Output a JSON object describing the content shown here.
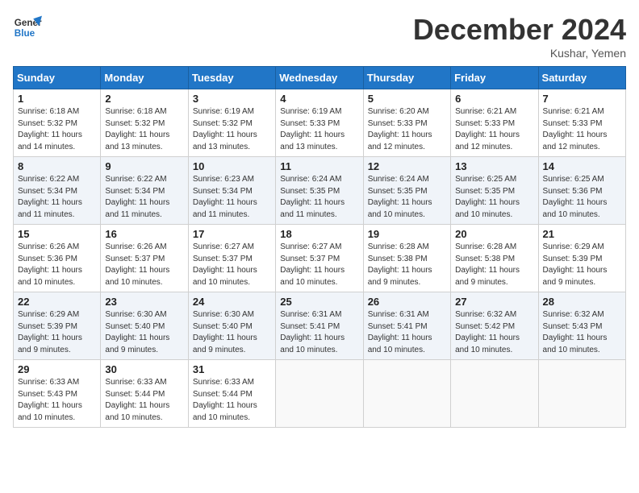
{
  "logo": {
    "line1": "General",
    "line2": "Blue"
  },
  "title": "December 2024",
  "location": "Kushar, Yemen",
  "weekdays": [
    "Sunday",
    "Monday",
    "Tuesday",
    "Wednesday",
    "Thursday",
    "Friday",
    "Saturday"
  ],
  "weeks": [
    [
      {
        "day": "1",
        "info": "Sunrise: 6:18 AM\nSunset: 5:32 PM\nDaylight: 11 hours\nand 14 minutes."
      },
      {
        "day": "2",
        "info": "Sunrise: 6:18 AM\nSunset: 5:32 PM\nDaylight: 11 hours\nand 13 minutes."
      },
      {
        "day": "3",
        "info": "Sunrise: 6:19 AM\nSunset: 5:32 PM\nDaylight: 11 hours\nand 13 minutes."
      },
      {
        "day": "4",
        "info": "Sunrise: 6:19 AM\nSunset: 5:33 PM\nDaylight: 11 hours\nand 13 minutes."
      },
      {
        "day": "5",
        "info": "Sunrise: 6:20 AM\nSunset: 5:33 PM\nDaylight: 11 hours\nand 12 minutes."
      },
      {
        "day": "6",
        "info": "Sunrise: 6:21 AM\nSunset: 5:33 PM\nDaylight: 11 hours\nand 12 minutes."
      },
      {
        "day": "7",
        "info": "Sunrise: 6:21 AM\nSunset: 5:33 PM\nDaylight: 11 hours\nand 12 minutes."
      }
    ],
    [
      {
        "day": "8",
        "info": "Sunrise: 6:22 AM\nSunset: 5:34 PM\nDaylight: 11 hours\nand 11 minutes."
      },
      {
        "day": "9",
        "info": "Sunrise: 6:22 AM\nSunset: 5:34 PM\nDaylight: 11 hours\nand 11 minutes."
      },
      {
        "day": "10",
        "info": "Sunrise: 6:23 AM\nSunset: 5:34 PM\nDaylight: 11 hours\nand 11 minutes."
      },
      {
        "day": "11",
        "info": "Sunrise: 6:24 AM\nSunset: 5:35 PM\nDaylight: 11 hours\nand 11 minutes."
      },
      {
        "day": "12",
        "info": "Sunrise: 6:24 AM\nSunset: 5:35 PM\nDaylight: 11 hours\nand 10 minutes."
      },
      {
        "day": "13",
        "info": "Sunrise: 6:25 AM\nSunset: 5:35 PM\nDaylight: 11 hours\nand 10 minutes."
      },
      {
        "day": "14",
        "info": "Sunrise: 6:25 AM\nSunset: 5:36 PM\nDaylight: 11 hours\nand 10 minutes."
      }
    ],
    [
      {
        "day": "15",
        "info": "Sunrise: 6:26 AM\nSunset: 5:36 PM\nDaylight: 11 hours\nand 10 minutes."
      },
      {
        "day": "16",
        "info": "Sunrise: 6:26 AM\nSunset: 5:37 PM\nDaylight: 11 hours\nand 10 minutes."
      },
      {
        "day": "17",
        "info": "Sunrise: 6:27 AM\nSunset: 5:37 PM\nDaylight: 11 hours\nand 10 minutes."
      },
      {
        "day": "18",
        "info": "Sunrise: 6:27 AM\nSunset: 5:37 PM\nDaylight: 11 hours\nand 10 minutes."
      },
      {
        "day": "19",
        "info": "Sunrise: 6:28 AM\nSunset: 5:38 PM\nDaylight: 11 hours\nand 9 minutes."
      },
      {
        "day": "20",
        "info": "Sunrise: 6:28 AM\nSunset: 5:38 PM\nDaylight: 11 hours\nand 9 minutes."
      },
      {
        "day": "21",
        "info": "Sunrise: 6:29 AM\nSunset: 5:39 PM\nDaylight: 11 hours\nand 9 minutes."
      }
    ],
    [
      {
        "day": "22",
        "info": "Sunrise: 6:29 AM\nSunset: 5:39 PM\nDaylight: 11 hours\nand 9 minutes."
      },
      {
        "day": "23",
        "info": "Sunrise: 6:30 AM\nSunset: 5:40 PM\nDaylight: 11 hours\nand 9 minutes."
      },
      {
        "day": "24",
        "info": "Sunrise: 6:30 AM\nSunset: 5:40 PM\nDaylight: 11 hours\nand 9 minutes."
      },
      {
        "day": "25",
        "info": "Sunrise: 6:31 AM\nSunset: 5:41 PM\nDaylight: 11 hours\nand 10 minutes."
      },
      {
        "day": "26",
        "info": "Sunrise: 6:31 AM\nSunset: 5:41 PM\nDaylight: 11 hours\nand 10 minutes."
      },
      {
        "day": "27",
        "info": "Sunrise: 6:32 AM\nSunset: 5:42 PM\nDaylight: 11 hours\nand 10 minutes."
      },
      {
        "day": "28",
        "info": "Sunrise: 6:32 AM\nSunset: 5:43 PM\nDaylight: 11 hours\nand 10 minutes."
      }
    ],
    [
      {
        "day": "29",
        "info": "Sunrise: 6:33 AM\nSunset: 5:43 PM\nDaylight: 11 hours\nand 10 minutes."
      },
      {
        "day": "30",
        "info": "Sunrise: 6:33 AM\nSunset: 5:44 PM\nDaylight: 11 hours\nand 10 minutes."
      },
      {
        "day": "31",
        "info": "Sunrise: 6:33 AM\nSunset: 5:44 PM\nDaylight: 11 hours\nand 10 minutes."
      },
      null,
      null,
      null,
      null
    ]
  ]
}
